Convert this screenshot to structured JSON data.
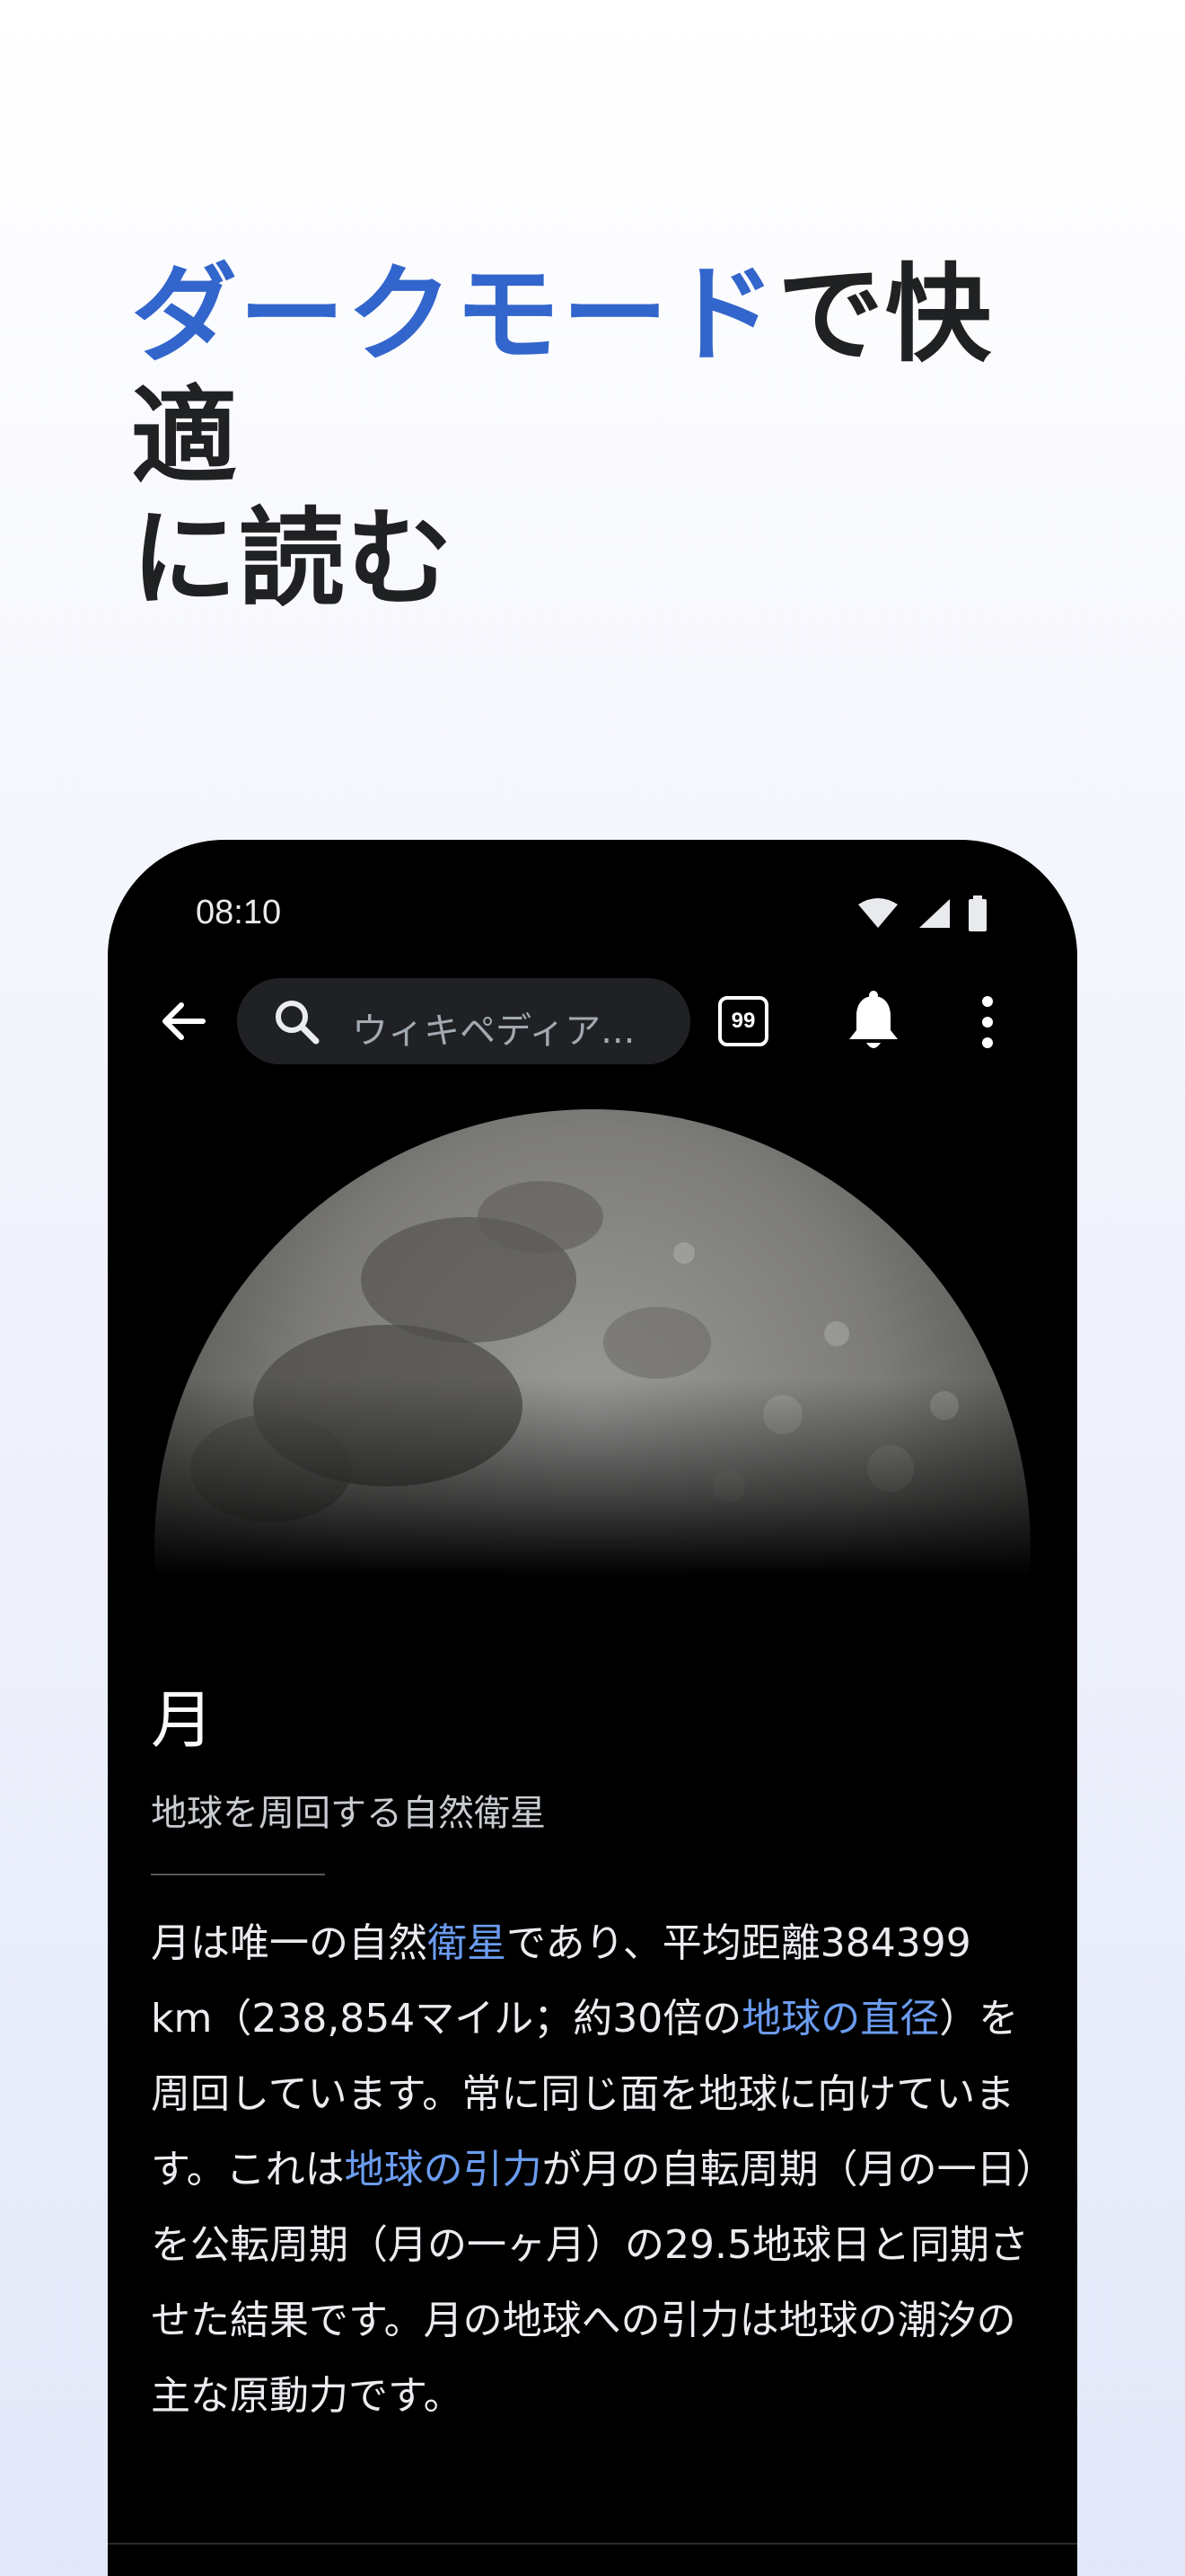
{
  "headline": {
    "accent": "ダークモード",
    "rest_line1": "で快適",
    "line2": "に読む"
  },
  "status_bar": {
    "time": "08:10",
    "icons": [
      "wifi-icon",
      "cell-signal-icon",
      "battery-icon"
    ]
  },
  "toolbar": {
    "search_placeholder": "ウィキペディア...",
    "tabs_count": "99",
    "icons": [
      "back-arrow-icon",
      "search-icon",
      "tabs-icon",
      "bell-icon",
      "more-vertical-icon"
    ]
  },
  "article": {
    "title": "月",
    "description": "地球を周回する自然衛星",
    "body": [
      {
        "text": "月は唯一の自然",
        "link": false
      },
      {
        "text": "衛星",
        "link": true
      },
      {
        "text": "であり、平均距離384399 km（238,854マイル；約30倍の",
        "link": false
      },
      {
        "text": "地球の直径",
        "link": true
      },
      {
        "text": "）を周回しています。常に同じ面を地球に向けています。これは",
        "link": false
      },
      {
        "text": "地球の引力",
        "link": true
      },
      {
        "text": "が月の自転周期（月の一日）を公転周期（月の一ヶ月）の29.5地球日と同期させた結果です。月の地球への引力は地球の潮汐の主な原動力です。",
        "link": false
      }
    ]
  },
  "colors": {
    "accent": "#3366cc",
    "link_dark": "#6b9cf0",
    "phone_bg": "#000000"
  }
}
